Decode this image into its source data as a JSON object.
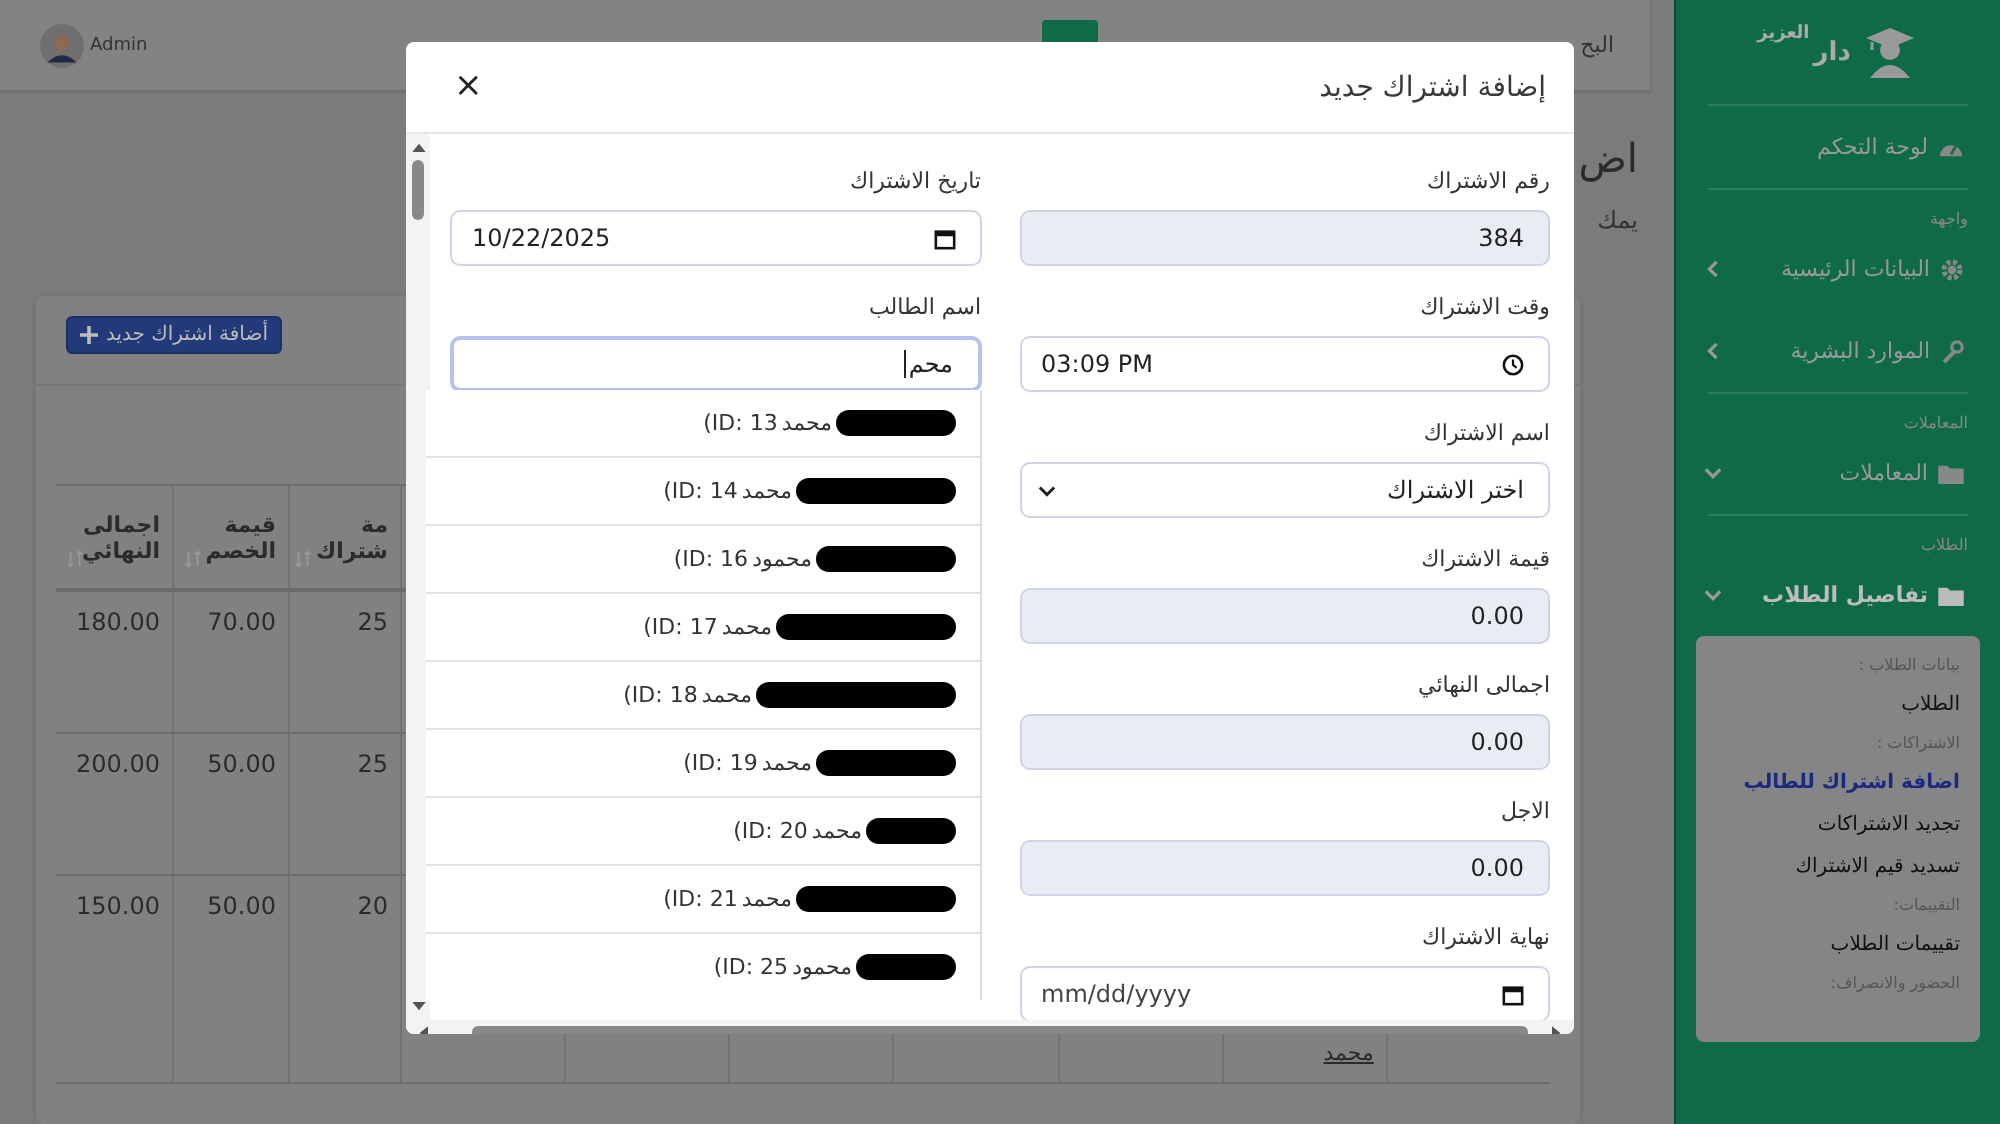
{
  "topbar": {
    "user": "Admin",
    "search_label": "البح"
  },
  "page": {
    "title": "اض",
    "subtitle": "يمك"
  },
  "card": {
    "add_button": "أضافة اشتراك جديد",
    "table": {
      "columns": [
        "مة شتراك",
        "قيمة الخصم",
        "اجمالى النهائي"
      ],
      "rows": [
        {
          "cells": [
            "25",
            "70.00",
            "180.00"
          ]
        },
        {
          "cells": [
            "25",
            "50.00",
            "200.00"
          ]
        },
        {
          "cells": [
            "20",
            "50.00",
            "150.00"
          ],
          "link": "محمد"
        }
      ]
    }
  },
  "sidebar": {
    "brand": {
      "name": "دار",
      "tagline": "العزيز"
    },
    "sections": [
      {
        "items": [
          {
            "label": "لوحة التحكم",
            "active": false
          }
        ]
      },
      {
        "heading": "واجهة",
        "items": [
          {
            "label": "البيانات الرئيسية",
            "active": false,
            "expanded": false
          },
          {
            "label": "الموارد البشرية",
            "active": false,
            "expanded": false
          }
        ]
      },
      {
        "heading": "المعاملات",
        "items": [
          {
            "label": "المعاملات",
            "active": false,
            "expanded": true
          }
        ]
      },
      {
        "heading": "الطلاب",
        "items": [
          {
            "label": "تفاصيل الطلاب",
            "active": true,
            "expanded": true,
            "submenu": [
              {
                "kind": "header",
                "label": "بيانات الطلاب :"
              },
              {
                "kind": "link",
                "label": "الطلاب",
                "selected": false
              },
              {
                "kind": "header",
                "label": "الاشتراكات :"
              },
              {
                "kind": "link",
                "label": "اضافة اشتراك للطالب",
                "selected": true
              },
              {
                "kind": "link",
                "label": "تجديد الاشتراكات",
                "selected": false
              },
              {
                "kind": "link",
                "label": "تسديد قيم الاشتراك",
                "selected": false
              },
              {
                "kind": "header",
                "label": "التقييمات:"
              },
              {
                "kind": "link",
                "label": "تقييمات الطلاب",
                "selected": false
              },
              {
                "kind": "header",
                "label": "الحضور والانصراف:"
              }
            ]
          }
        ]
      }
    ]
  },
  "modal": {
    "title": "إضافة اشتراك جديد",
    "close": "×",
    "columns": [
      [
        {
          "label": "رقم الاشتراك",
          "kind": "readonly",
          "value": "384"
        },
        {
          "label": "وقت الاشتراك",
          "kind": "time",
          "value": "03:09 PM"
        },
        {
          "label": "اسم الاشتراك",
          "kind": "select",
          "value": "اختر الاشتراك"
        },
        {
          "label": "قيمة الاشتراك",
          "kind": "readonly",
          "value": "0.00"
        },
        {
          "label": "اجمالى النهائي",
          "kind": "readonly",
          "value": "0.00"
        },
        {
          "label": "الاجل",
          "kind": "readonly",
          "value": "0.00"
        },
        {
          "label": "نهاية الاشتراك",
          "kind": "date",
          "placeholder": "mm/dd/yyyy"
        }
      ],
      [
        {
          "label": "تاريخ الاشتراك",
          "kind": "date",
          "value": "10/22/2025"
        },
        {
          "label": "اسم الطالب",
          "kind": "text",
          "value": "محم",
          "focused": true
        }
      ]
    ],
    "suggestions": [
      {
        "name": "محمد",
        "id": "(ID: 13"
      },
      {
        "name": "محمد",
        "id": "(ID: 14"
      },
      {
        "name": "محمود",
        "id": "(ID: 16"
      },
      {
        "name": "محمد",
        "id": "(ID: 17"
      },
      {
        "name": "محمد",
        "id": "(ID: 18"
      },
      {
        "name": "محمد",
        "id": "(ID: 19"
      },
      {
        "name": "محمد",
        "id": "(ID: 20"
      },
      {
        "name": "محمد",
        "id": "(ID: 21"
      },
      {
        "name": "محمود",
        "id": "(ID: 25"
      }
    ]
  }
}
